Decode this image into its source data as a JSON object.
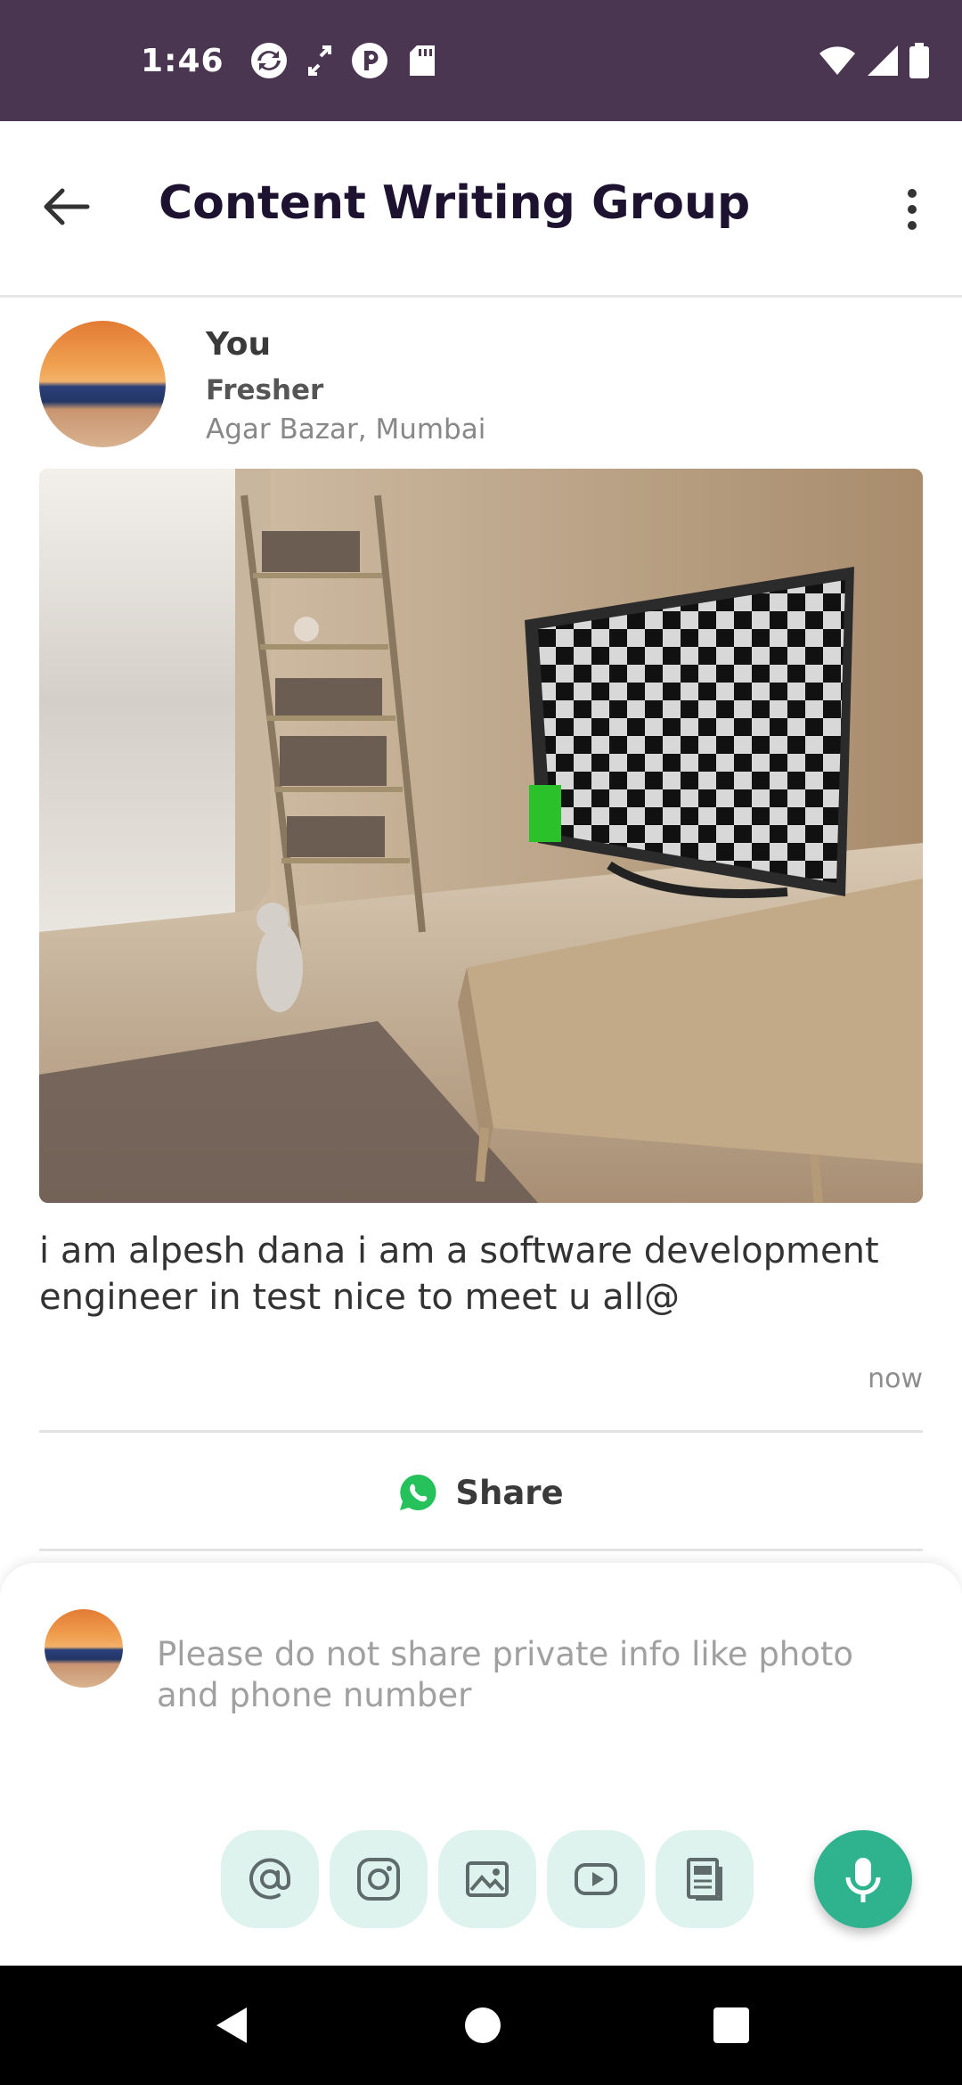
{
  "status_bar": {
    "time": "1:46",
    "left_icons": [
      "sync-icon",
      "expand-icon",
      "p-icon",
      "sd-card-icon"
    ],
    "right_icons": [
      "wifi-icon",
      "signal-icon",
      "battery-icon"
    ]
  },
  "app_bar": {
    "title": "Content Writing Group",
    "back_icon": "arrow-left-icon",
    "menu_icon": "more-vert-icon"
  },
  "post": {
    "author": "You",
    "role": "Fresher",
    "location": "Agar Bazar, Mumbai",
    "body": "i am alpesh dana i am a software development engineer in test nice to meet u all@",
    "timestamp": "now",
    "share_label": "Share",
    "share_icon": "whatsapp-icon"
  },
  "composer": {
    "placeholder": "Please do not share private info like photo and phone number",
    "tools": [
      "at-icon",
      "instagram-icon",
      "image-icon",
      "youtube-icon",
      "document-icon"
    ],
    "mic_icon": "mic-icon"
  },
  "colors": {
    "status_bar": "#4a3650",
    "accent": "#2fb38e",
    "tool_bg": "#dff3ee"
  }
}
